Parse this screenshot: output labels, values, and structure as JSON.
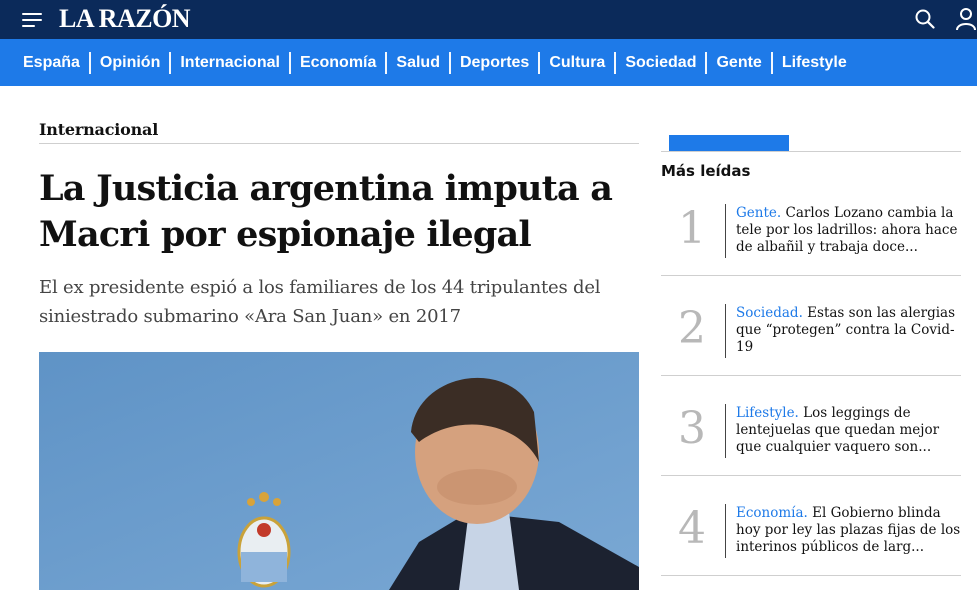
{
  "header": {
    "logo": "LA RAZÓN",
    "menu_icon": "hamburger-menu-icon",
    "search_icon": "search-icon",
    "user_icon": "user-icon"
  },
  "nav": {
    "items": [
      "España",
      "Opinión",
      "Internacional",
      "Economía",
      "Salud",
      "Deportes",
      "Cultura",
      "Sociedad",
      "Gente",
      "Lifestyle"
    ]
  },
  "article": {
    "section": "Internacional",
    "headline": "La Justicia argentina imputa a Macri por espionaje ilegal",
    "subtitle": "El ex presidente espió a los familiares de los 44 tripulantes del siniestrado submarino «Ara San Juan» en 2017"
  },
  "sidebar": {
    "title": "Más leídas",
    "items": [
      {
        "rank": "1",
        "category": "Gente.",
        "text": "Carlos Lozano cambia la tele por los ladrillos: ahora hace de albañil y trabaja doce..."
      },
      {
        "rank": "2",
        "category": "Sociedad.",
        "text": "Estas son las alergias que “protegen” contra la Covid-19"
      },
      {
        "rank": "3",
        "category": "Lifestyle.",
        "text": "Los leggings de lentejuelas que quedan mejor que cualquier vaquero son..."
      },
      {
        "rank": "4",
        "category": "Economía.",
        "text": "El Gobierno blinda hoy por ley las plazas fijas de los interinos públicos de larg..."
      }
    ]
  },
  "colors": {
    "topbar": "#0b2a5a",
    "navbar": "#1e7ae8",
    "category_link": "#1e7ae8",
    "rank_number": "#b8b8b8"
  }
}
